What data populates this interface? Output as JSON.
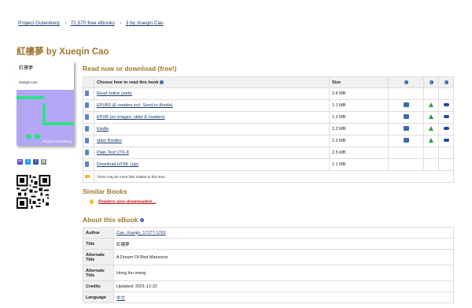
{
  "breadcrumb": {
    "items": [
      "Project Gutenberg",
      "72,570 free eBooks",
      "3 by Xueqin Cao"
    ]
  },
  "page_title": "紅樓夢 by Xueqin Cao",
  "cover": {
    "title": "紅樓夢",
    "author": "Xueqin Cao",
    "publisher": "Project Gutenberg",
    "colors": {
      "top": "#ffffff",
      "body": "#b3a7f5",
      "accent": "#2ee08a"
    }
  },
  "social": [
    "mastodon-icon",
    "twitter-icon",
    "facebook-icon",
    "print-icon"
  ],
  "download": {
    "heading": "Read now or download (free!)",
    "table_header": {
      "choose": "Choose how to read this book",
      "size": "Size"
    },
    "rows": [
      {
        "label": "Read online (web)",
        "size": "2.6 MB",
        "send": false,
        "drive": false,
        "cloud": false
      },
      {
        "label": "EPUB3 (E-readers incl. Send-to-Kindle)",
        "size": "1.1 MB",
        "send": true,
        "drive": true,
        "cloud": true
      },
      {
        "label": "EPUB (no images, older E-readers)",
        "size": "1.2 MB",
        "send": true,
        "drive": true,
        "cloud": true
      },
      {
        "label": "Kindle",
        "size": "2.2 MB",
        "send": true,
        "drive": true,
        "cloud": true
      },
      {
        "label": "older Kindles",
        "size": "2.2 MB",
        "send": true,
        "drive": true,
        "cloud": true
      },
      {
        "label": "Plain Text UTF-8",
        "size": "2.5 MB",
        "send": false,
        "drive": false,
        "cloud": false
      },
      {
        "label": "Download HTML (zip)",
        "size": "1.1 MB",
        "send": false,
        "drive": false,
        "cloud": false
      }
    ],
    "note": "There may be more files related to this item."
  },
  "similar": {
    "heading": "Similar Books",
    "link": "Readers also downloaded…"
  },
  "about": {
    "heading": "About this eBook",
    "rows": [
      {
        "key": "Author",
        "value": "Cao, Xueqin, 1717?-1763",
        "link": true
      },
      {
        "key": "Title",
        "value": "紅樓夢",
        "link": false
      },
      {
        "key": "Alternate Title",
        "value": "A Dream Of Red Mansions",
        "link": false
      },
      {
        "key": "Alternate Title",
        "value": "Hong lou meng",
        "link": false
      },
      {
        "key": "Credits",
        "value": "Updated: 2021-12-22",
        "link": false
      },
      {
        "key": "Language",
        "value": "中文",
        "link": true
      }
    ]
  }
}
